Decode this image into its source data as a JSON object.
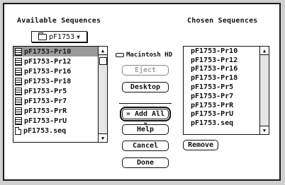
{
  "left_title": "Available Sequences",
  "right_title": "Chosen Sequences",
  "folder_popup": {
    "label": "pF1753"
  },
  "available": {
    "items": [
      {
        "label": "pF1753-Pr10",
        "kind": "file",
        "selected": true
      },
      {
        "label": "pF1753-Pr12",
        "kind": "file"
      },
      {
        "label": "pF1753-Pr16",
        "kind": "file"
      },
      {
        "label": "pF1753-Pr18",
        "kind": "file"
      },
      {
        "label": "pF1753-Pr5",
        "kind": "file"
      },
      {
        "label": "pF1753-Pr7",
        "kind": "file"
      },
      {
        "label": "pF1753-PrR",
        "kind": "file"
      },
      {
        "label": "pF1753-PrU",
        "kind": "file"
      },
      {
        "label": "pF1753.seq",
        "kind": "doc"
      }
    ]
  },
  "chosen": {
    "items": [
      {
        "label": "pF1753-Pr10"
      },
      {
        "label": "pF1753-Pr12"
      },
      {
        "label": "pF1753-Pr16"
      },
      {
        "label": "pF1753-Pr18"
      },
      {
        "label": "pF1753-Pr5"
      },
      {
        "label": "pF1753-Pr7"
      },
      {
        "label": "pF1753-PrR"
      },
      {
        "label": "pF1753-PrU"
      },
      {
        "label": "pF1753.seq"
      }
    ]
  },
  "disk": {
    "label": "Macintosh HD"
  },
  "buttons": {
    "eject": "Eject",
    "desktop": "Desktop",
    "add_all": "» Add All »",
    "help": "Help",
    "cancel": "Cancel",
    "done": "Done",
    "remove": "Remove"
  }
}
